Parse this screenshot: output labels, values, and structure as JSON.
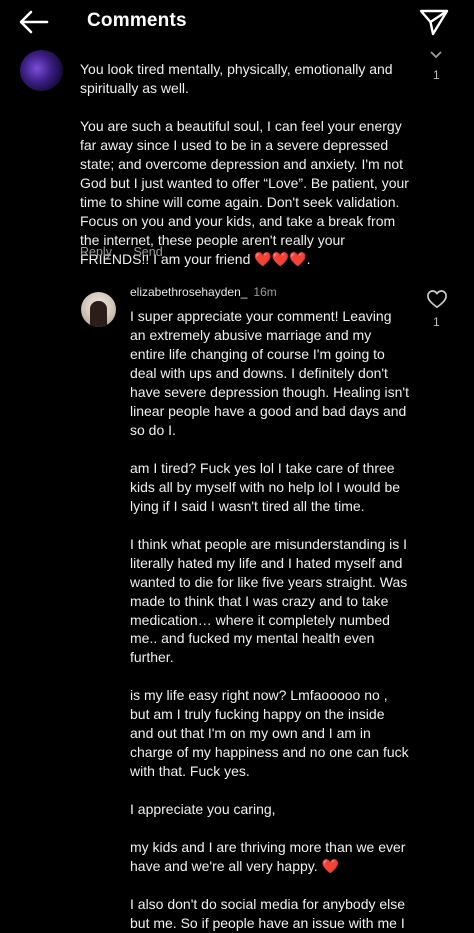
{
  "header": {
    "title": "Comments",
    "back_icon": "arrow-left-icon",
    "share_icon": "paper-plane-icon"
  },
  "comment1": {
    "avatar_icon": "user-avatar",
    "text": "You look tired mentally, physically, emotionally and spiritually as well.\n\nYou are such a beautiful soul, I can feel your energy far away since I used to be in a severe depressed state; and overcome depression and anxiety. I'm not God but I just wanted to offer “Love”. Be patient, your time to shine will come again. Don't seek validation. Focus on you and your kids, and take a break from the internet, these people aren't really your FRIENDS!! I am your friend ❤️❤️❤️.",
    "like_count": "1",
    "actions": {
      "reply": "Reply",
      "send": "Send"
    }
  },
  "reply1": {
    "username": "elizabethrosehayden_",
    "time": "16m",
    "like_count": "1",
    "text": "I super appreciate your comment! Leaving an extremely abusive marriage and my entire life changing of course I'm going to deal with ups and downs. I definitely don't have severe depression though. Healing isn't linear people have a good and bad days and so do I.\n\nam I tired? Fuck yes lol I take care of three kids all by myself with no help lol I would be lying if I said I wasn't tired all the time.\n\nI think what people are misunderstanding is I literally hated my life and I hated myself and wanted to die for like five years straight. Was made to think that I was crazy and to take medication… where it completely numbed me.. and fucked my mental health even further.\n\nis my life easy right now? Lmfaooooo no , but am I truly fucking happy on the inside and out that I'm on my own and I am in charge of my happiness and no one can fuck with that. Fuck yes.\n\nI appreciate you caring,\n\nmy kids and I are thriving more than we ever have and we're all very happy. ❤️\n\nI also don't do social media for anybody else but me. So if people have an issue with me I",
    "heart_icon": "heart-outline-icon"
  },
  "colors": {
    "background": "#000000",
    "text": "#f0f0f0",
    "muted": "#9b9b9b",
    "heart": "#ef4a4a"
  }
}
